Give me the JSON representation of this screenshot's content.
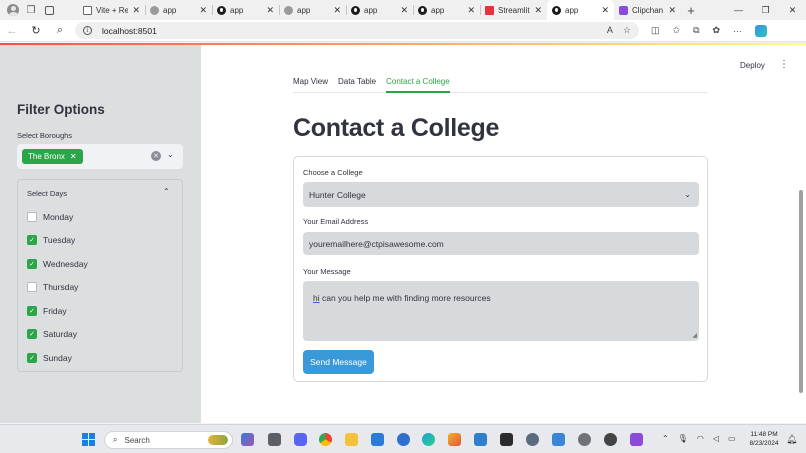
{
  "browser": {
    "tabs": [
      {
        "title": "Vite + Re",
        "favicon": "doc-favicon",
        "active": false
      },
      {
        "title": "app",
        "favicon": "grey-favicon",
        "active": false
      },
      {
        "title": "app",
        "favicon": "github-favicon",
        "active": false
      },
      {
        "title": "app",
        "favicon": "grey-favicon",
        "active": false
      },
      {
        "title": "app",
        "favicon": "github-favicon",
        "active": false
      },
      {
        "title": "app",
        "favicon": "github-favicon",
        "active": false
      },
      {
        "title": "Streamlit",
        "favicon": "streamlit-favicon",
        "active": false
      },
      {
        "title": "app",
        "favicon": "github-favicon",
        "active": true
      },
      {
        "title": "Clipchan",
        "favicon": "clipchamp-favicon",
        "active": false
      }
    ],
    "url": "localhost:8501"
  },
  "sidebar": {
    "title": "Filter Options",
    "boroughs_label": "Select Boroughs",
    "selected_borough": "The Bronx",
    "days_label": "Select Days",
    "days": [
      {
        "label": "Monday",
        "checked": false
      },
      {
        "label": "Tuesday",
        "checked": true
      },
      {
        "label": "Wednesday",
        "checked": true
      },
      {
        "label": "Thursday",
        "checked": false
      },
      {
        "label": "Friday",
        "checked": true
      },
      {
        "label": "Saturday",
        "checked": true
      },
      {
        "label": "Sunday",
        "checked": true
      }
    ]
  },
  "header": {
    "deploy_label": "Deploy"
  },
  "main": {
    "tabs": [
      {
        "label": "Map View",
        "active": false
      },
      {
        "label": "Data Table",
        "active": false
      },
      {
        "label": "Contact a College",
        "active": true
      }
    ],
    "title": "Contact a College",
    "form": {
      "college_label": "Choose a College",
      "college_value": "Hunter College",
      "email_label": "Your Email Address",
      "email_value": "youremailhere@ctpisawesome.com",
      "message_label": "Your Message",
      "message_first_word": "hi",
      "message_rest": " can you help me with finding more resources",
      "send_label": "Send Message"
    }
  },
  "taskbar": {
    "search_placeholder": "Search",
    "time": "11:48 PM",
    "date": "8/23/2024"
  },
  "colors": {
    "accent_green": "#2aa649",
    "button_blue": "#3a9ad9",
    "sidebar_bg": "#dcdfe0"
  }
}
